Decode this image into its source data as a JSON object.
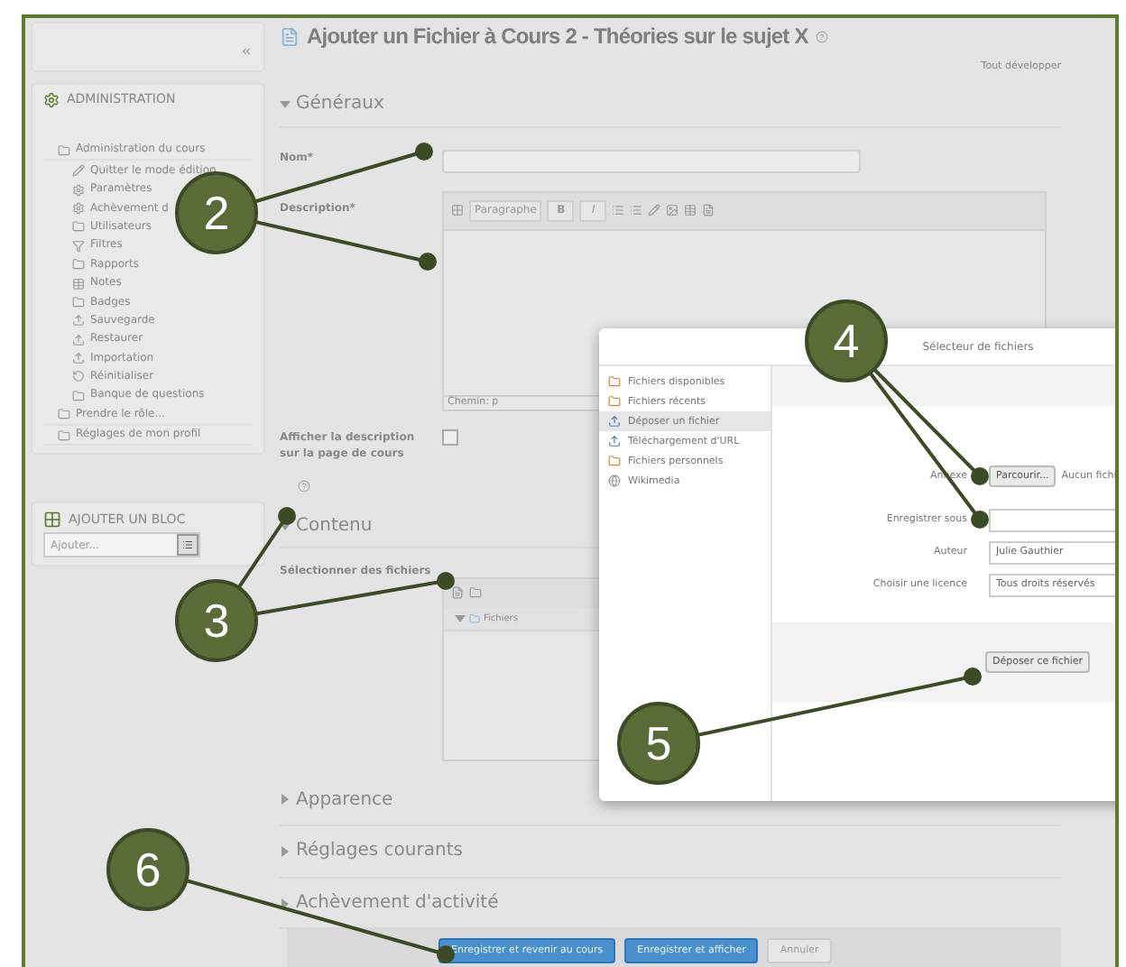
{
  "sidebar": {
    "admin": {
      "title": "ADMINISTRATION",
      "items": [
        {
          "label": "Administration du cours",
          "children": [
            {
              "label": "Quitter le mode édition"
            },
            {
              "label": "Paramètres"
            },
            {
              "label": "Achèvement d"
            },
            {
              "label": "Utilisateurs"
            },
            {
              "label": "Filtres"
            },
            {
              "label": "Rapports"
            },
            {
              "label": "Notes"
            },
            {
              "label": "Badges"
            },
            {
              "label": "Sauvegarde"
            },
            {
              "label": "Restaurer"
            },
            {
              "label": "Importation"
            },
            {
              "label": "Réinitialiser"
            },
            {
              "label": "Banque de questions"
            }
          ]
        },
        {
          "label": "Prendre le rôle..."
        },
        {
          "label": "Réglages de mon profil"
        }
      ]
    },
    "add_block": {
      "title": "AJOUTER UN BLOC",
      "select": "Ajouter..."
    }
  },
  "page": {
    "title": "Ajouter un Fichier à Cours 2 - Théories sur le sujet X",
    "expand_all": "Tout développer"
  },
  "general": {
    "title": "Généraux",
    "expanded": true,
    "name_label": "Nom*",
    "description_label": "Description*",
    "editor": {
      "format": "Paragraphe",
      "bold": "B",
      "italic": "I",
      "path": "Chemin: p"
    },
    "show_description": {
      "label": "Afficher la description sur la page de cours",
      "checked": false
    }
  },
  "content": {
    "title": "Contenu",
    "expanded": true,
    "files_label": "Sélectionner des fichiers",
    "folder": "Fichiers"
  },
  "collapsed_sections": [
    {
      "title": "Apparence",
      "expanded": false
    },
    {
      "title": "Réglages courants",
      "expanded": false
    },
    {
      "title": "Achèvement d'activité",
      "expanded": false
    }
  ],
  "buttons": [
    {
      "label": "Enregistrer et revenir au cours",
      "kind": "primary"
    },
    {
      "label": "Enregistrer et afficher",
      "kind": "primary"
    },
    {
      "label": "Annuler",
      "kind": "cancel"
    }
  ],
  "file_picker": {
    "title": "Sélecteur de fichiers",
    "repositories": [
      {
        "label": "Fichiers disponibles",
        "selected": false,
        "kind": "files"
      },
      {
        "label": "Fichiers récents",
        "selected": false,
        "kind": "files"
      },
      {
        "label": "Déposer un fichier",
        "selected": true,
        "kind": "upload"
      },
      {
        "label": "Téléchargement d'URL",
        "selected": false,
        "kind": "upload"
      },
      {
        "label": "Fichiers personnels",
        "selected": false,
        "kind": "files"
      },
      {
        "label": "Wikimedia",
        "selected": false,
        "kind": "web"
      }
    ],
    "attachment_label": "Annexe",
    "browse_button": "Parcourir...",
    "no_file": "Aucun fichi",
    "save_as_label": "Enregistrer sous",
    "author_label": "Auteur",
    "author": "Julie Gauthier",
    "license_label": "Choisir une licence",
    "license": "Tous droits réservés",
    "upload_button": "Déposer ce fichier"
  },
  "callouts": [
    {
      "number": "2"
    },
    {
      "number": "3"
    },
    {
      "number": "4"
    },
    {
      "number": "5"
    },
    {
      "number": "6"
    }
  ]
}
